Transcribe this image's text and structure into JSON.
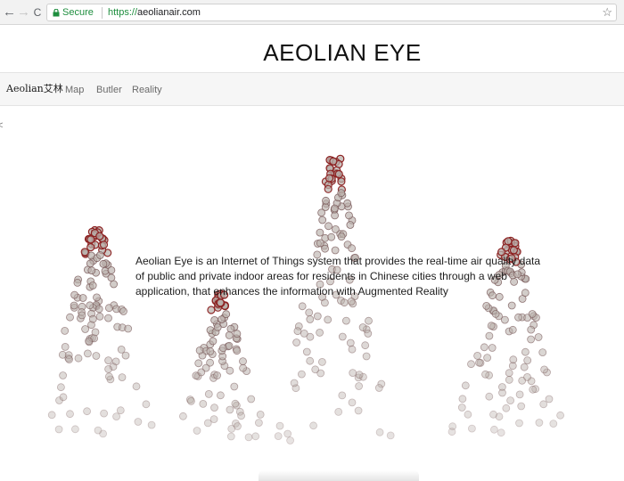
{
  "browser": {
    "secure_label": "Secure",
    "url_scheme": "https://",
    "url_host": "aeolianair.com",
    "back_glyph": "←",
    "forward_glyph": "→",
    "reload_glyph": "C",
    "bookmark_glyph": "☆"
  },
  "site": {
    "title": "AEOLIAN EYE",
    "brand": "Aeolian艾林",
    "nav": [
      {
        "label": "Map"
      },
      {
        "label": "Butler"
      },
      {
        "label": "Reality"
      }
    ],
    "corner_glyph": "<",
    "description": "Aeolian Eye is an Internet of Things system that provides the real-time air quality data of public and private indoor areas for residents in Chinese cities through a web application, that enhances the information with Augmented Reality"
  },
  "colors": {
    "secure_green": "#1e8e3e",
    "particle_stroke": "#8b1f1f",
    "particle_fill": "#b9b0ab"
  }
}
